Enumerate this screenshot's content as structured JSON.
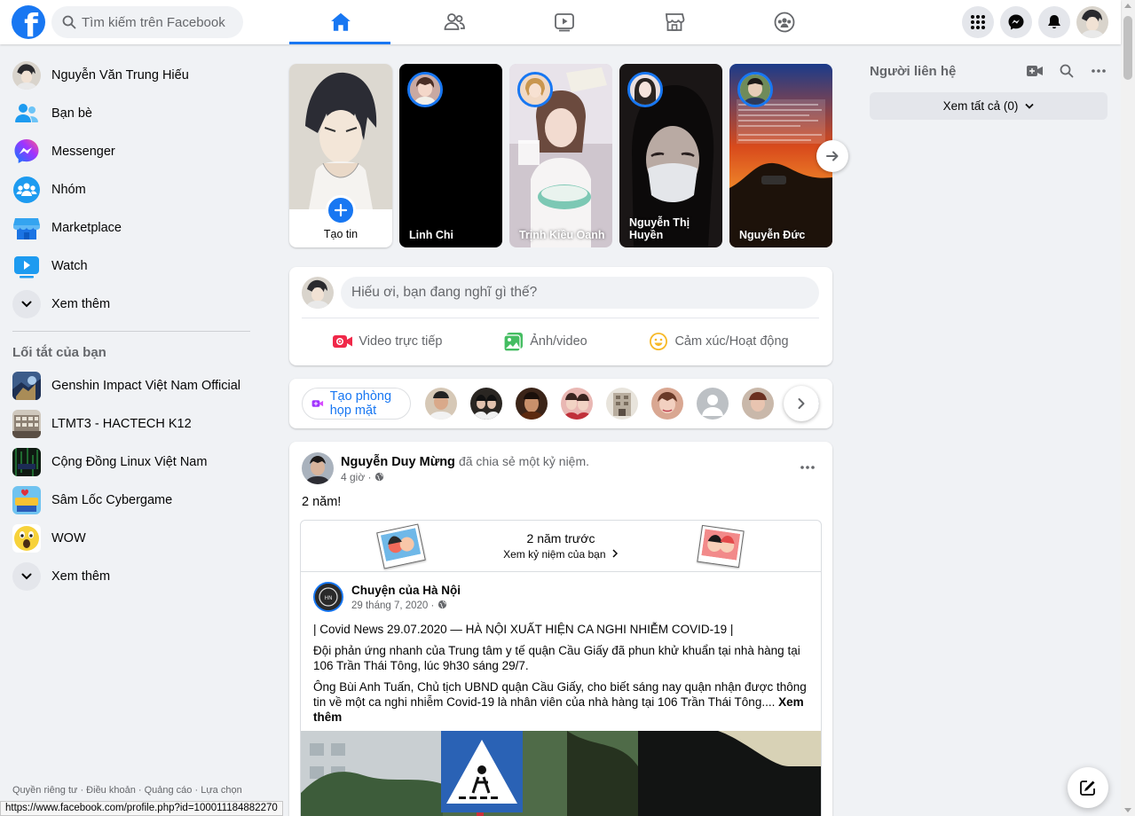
{
  "search": {
    "placeholder": "Tìm kiếm trên Facebook"
  },
  "nav": {
    "tabs": [
      "home",
      "friends",
      "watch",
      "marketplace",
      "groups"
    ],
    "active": "home"
  },
  "colors": {
    "brand": "#1877f2",
    "background": "#f0f2f5",
    "text_secondary": "#65676b"
  },
  "sidebar": {
    "items": [
      {
        "label": "Nguyễn Văn Trung Hiếu",
        "icon": "profile-avatar"
      },
      {
        "label": "Bạn bè",
        "icon": "friends-icon"
      },
      {
        "label": "Messenger",
        "icon": "messenger-icon"
      },
      {
        "label": "Nhóm",
        "icon": "groups-icon"
      },
      {
        "label": "Marketplace",
        "icon": "marketplace-icon"
      },
      {
        "label": "Watch",
        "icon": "watch-icon"
      },
      {
        "label": "Xem thêm",
        "icon": "chevron-down-icon"
      }
    ],
    "shortcuts_title": "Lối tắt của bạn",
    "shortcuts": [
      {
        "label": "Genshin Impact Việt Nam Official"
      },
      {
        "label": "LTMT3 - HACTECH K12"
      },
      {
        "label": "Cộng Đồng Linux Việt Nam"
      },
      {
        "label": "Sâm Lốc Cybergame"
      },
      {
        "label": "WOW"
      },
      {
        "label": "Xem thêm"
      }
    ],
    "footer": "Quyền riêng tư · Điều khoản · Quảng cáo · Lựa chọn"
  },
  "status_url": "https://www.facebook.com/profile.php?id=100011184882270",
  "stories": {
    "create_label": "Tạo tin",
    "items": [
      {
        "name": "Linh Chi"
      },
      {
        "name": "Trịnh Kiều Oanh"
      },
      {
        "name": "Nguyễn Thị Huyền"
      },
      {
        "name": "Nguyễn Đức"
      }
    ]
  },
  "composer": {
    "placeholder": "Hiếu ơi, bạn đang nghĩ gì thế?",
    "actions": [
      {
        "label": "Video trực tiếp",
        "icon": "live-video-icon"
      },
      {
        "label": "Ảnh/video",
        "icon": "photo-icon"
      },
      {
        "label": "Cảm xúc/Hoạt động",
        "icon": "feeling-icon"
      }
    ]
  },
  "rooms": {
    "button_label": "Tạo phòng họp mặt"
  },
  "post": {
    "author": "Nguyễn Duy Mừng",
    "action": "đã chia sẻ một kỷ niệm.",
    "time": "4 giờ ·",
    "text": "2 năm!",
    "memory": {
      "title": "2 năm trước",
      "link": "Xem kỷ niệm của bạn"
    },
    "shared": {
      "page": "Chuyện của Hà Nội",
      "date": "29 tháng 7, 2020 ·",
      "p1": "| Covid News 29.07.2020 — HÀ NỘI XUẤT HIỆN CA NGHI NHIỄM COVID-19 |",
      "p2": "Đội phản ứng nhanh của Trung tâm y tế quận Cầu Giấy đã phun khử khuẩn tại nhà hàng tại 106 Trần Thái Tông, lúc 9h30 sáng 29/7.",
      "p3": "Ông Bùi Anh Tuấn, Chủ tịch UBND quận Cầu Giấy, cho biết sáng nay quận nhận được thông tin về một ca nghi nhiễm Covid-19 là nhân viên của nhà hàng tại 106 Trần Thái Tông....",
      "see_more": "Xem thêm"
    }
  },
  "contacts": {
    "title": "Người liên hệ",
    "see_all": "Xem tất cả (0)"
  }
}
